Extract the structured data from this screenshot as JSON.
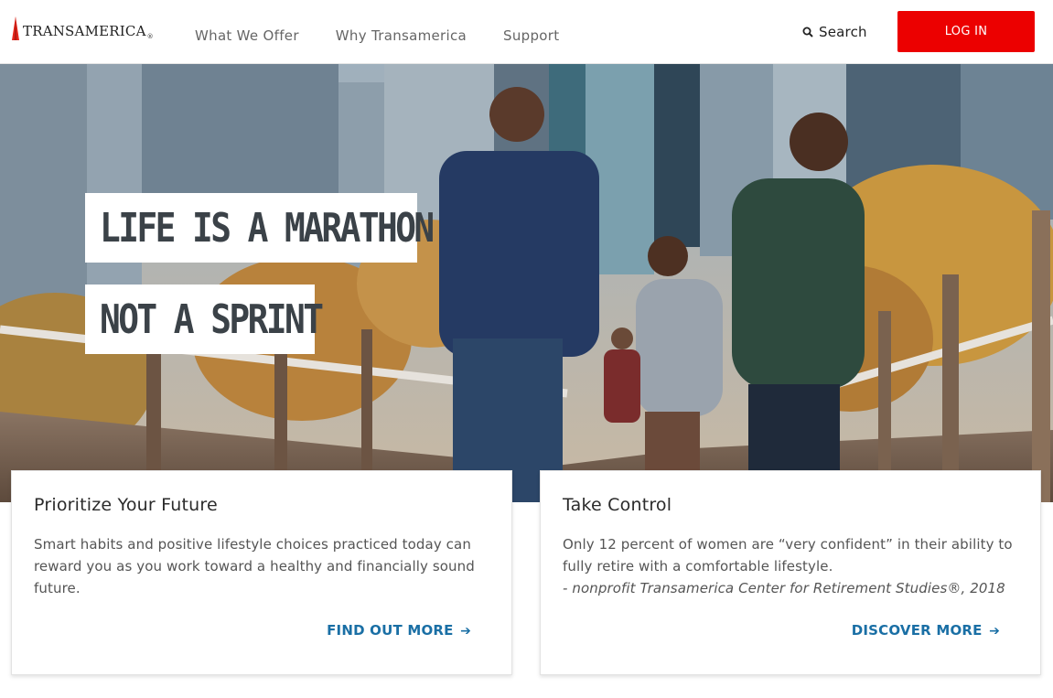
{
  "brand": {
    "logo_text": "TRANSAMERICA",
    "logo_icon": "pyramid-logo-icon",
    "accent_color": "#ec0000",
    "link_color": "#1a6fa5"
  },
  "nav": {
    "items": [
      {
        "label": "What We Offer"
      },
      {
        "label": "Why Transamerica"
      },
      {
        "label": "Support"
      }
    ]
  },
  "search": {
    "label": "Search",
    "icon": "search-icon"
  },
  "login": {
    "label": "LOG IN"
  },
  "hero": {
    "headline_line1": "LIFE IS A MARATHON",
    "headline_line2": "NOT A SPRINT"
  },
  "cards": [
    {
      "title": "Prioritize Your Future",
      "body": "Smart habits and positive lifestyle choices practiced today can reward you as you work toward a healthy and financially sound future.",
      "cite": "",
      "link": "FIND OUT MORE"
    },
    {
      "title": "Take Control",
      "body": "Only 12 percent of women are “very confident” in their ability to fully retire with a comfortable lifestyle.",
      "cite": "- nonprofit Transamerica Center for Retirement Studies®, 2018",
      "link": "DISCOVER MORE"
    }
  ]
}
